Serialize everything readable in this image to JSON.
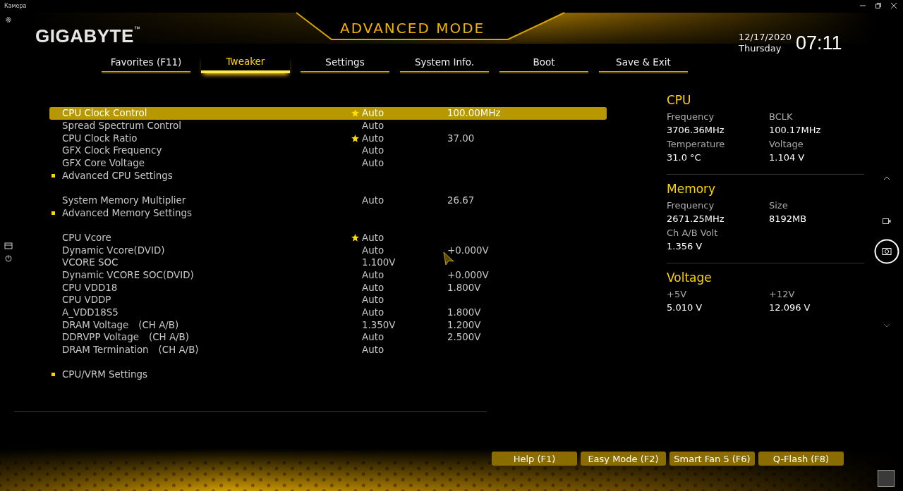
{
  "app_window": {
    "title": "Камера"
  },
  "bios": {
    "brand": "GIGABYTE",
    "brand_mark": "™",
    "mode_title": "ADVANCED MODE",
    "date": "12/17/2020",
    "weekday": "Thursday",
    "time": "07:11",
    "tabs": [
      {
        "label": "Favorites (F11)",
        "selected": false
      },
      {
        "label": "Tweaker",
        "selected": true
      },
      {
        "label": "Settings",
        "selected": false
      },
      {
        "label": "System Info.",
        "selected": false
      },
      {
        "label": "Boot",
        "selected": false
      },
      {
        "label": "Save & Exit",
        "selected": false
      }
    ],
    "setting_groups": [
      {
        "items": [
          {
            "kind": "setting",
            "name": "CPU Clock Control",
            "favorite": true,
            "value": "Auto",
            "reading": "100.00MHz",
            "selected": true
          },
          {
            "kind": "setting",
            "name": "Spread Spectrum Control",
            "favorite": false,
            "value": "Auto",
            "selected": false
          },
          {
            "kind": "setting",
            "name": "CPU Clock Ratio",
            "favorite": true,
            "value": "Auto",
            "reading": "37.00",
            "selected": false
          },
          {
            "kind": "setting",
            "name": "GFX Clock Frequency",
            "favorite": false,
            "value": "Auto",
            "selected": false
          },
          {
            "kind": "setting",
            "name": "GFX Core Voltage",
            "favorite": false,
            "value": "Auto",
            "selected": false
          },
          {
            "kind": "submenu",
            "name": "Advanced CPU Settings",
            "selected": false
          }
        ]
      },
      {
        "items": [
          {
            "kind": "setting",
            "name": "System Memory Multiplier",
            "favorite": false,
            "value": "Auto",
            "reading": "26.67",
            "selected": false
          },
          {
            "kind": "submenu",
            "name": "Advanced Memory Settings",
            "selected": false
          }
        ]
      },
      {
        "items": [
          {
            "kind": "setting",
            "name": "CPU Vcore",
            "favorite": true,
            "value": "Auto",
            "selected": false
          },
          {
            "kind": "setting",
            "name": "Dynamic Vcore(DVID)",
            "favorite": false,
            "value": "Auto",
            "reading": "+0.000V",
            "selected": false
          },
          {
            "kind": "setting",
            "name": "VCORE SOC",
            "favorite": false,
            "value": "1.100V",
            "selected": false
          },
          {
            "kind": "setting",
            "name": "Dynamic VCORE SOC(DVID)",
            "favorite": false,
            "value": "Auto",
            "reading": "+0.000V",
            "selected": false
          },
          {
            "kind": "setting",
            "name": "CPU VDD18",
            "favorite": false,
            "value": "Auto",
            "reading": "1.800V",
            "selected": false
          },
          {
            "kind": "setting",
            "name": "CPU VDDP",
            "favorite": false,
            "value": "Auto",
            "selected": false
          },
          {
            "kind": "setting",
            "name": "A_VDD18S5",
            "favorite": false,
            "value": "Auto",
            "reading": "1.800V",
            "selected": false
          },
          {
            "kind": "setting",
            "name": "DRAM Voltage",
            "channel": "(CH A/B)",
            "favorite": false,
            "value": "1.350V",
            "reading": "1.200V",
            "selected": false
          },
          {
            "kind": "setting",
            "name": "DDRVPP Voltage",
            "channel": "(CH A/B)",
            "favorite": false,
            "value": "Auto",
            "reading": "2.500V",
            "selected": false
          },
          {
            "kind": "setting",
            "name": "DRAM Termination",
            "channel": "(CH A/B)",
            "favorite": false,
            "value": "Auto",
            "selected": false
          }
        ]
      },
      {
        "items": [
          {
            "kind": "submenu",
            "name": "CPU/VRM Settings",
            "selected": false
          }
        ]
      }
    ],
    "monitor": [
      {
        "title": "CPU",
        "fields": [
          {
            "label": "Frequency",
            "value": "3706.36MHz"
          },
          {
            "label": "BCLK",
            "value": "100.17MHz"
          },
          {
            "label": "Temperature",
            "value": "31.0 °C"
          },
          {
            "label": "Voltage",
            "value": "1.104 V"
          }
        ]
      },
      {
        "title": "Memory",
        "fields": [
          {
            "label": "Frequency",
            "value": "2671.25MHz"
          },
          {
            "label": "Size",
            "value": "8192MB"
          },
          {
            "label": "Ch A/B Volt",
            "value": "1.356 V"
          }
        ]
      },
      {
        "title": "Voltage",
        "fields": [
          {
            "label": "+5V",
            "value": "5.010 V"
          },
          {
            "label": "+12V",
            "value": "12.096 V"
          }
        ]
      }
    ],
    "function_keys": [
      {
        "label": "Help (F1)"
      },
      {
        "label": "Easy Mode (F2)"
      },
      {
        "label": "Smart Fan 5 (F6)"
      },
      {
        "label": "Q-Flash (F8)"
      }
    ]
  }
}
